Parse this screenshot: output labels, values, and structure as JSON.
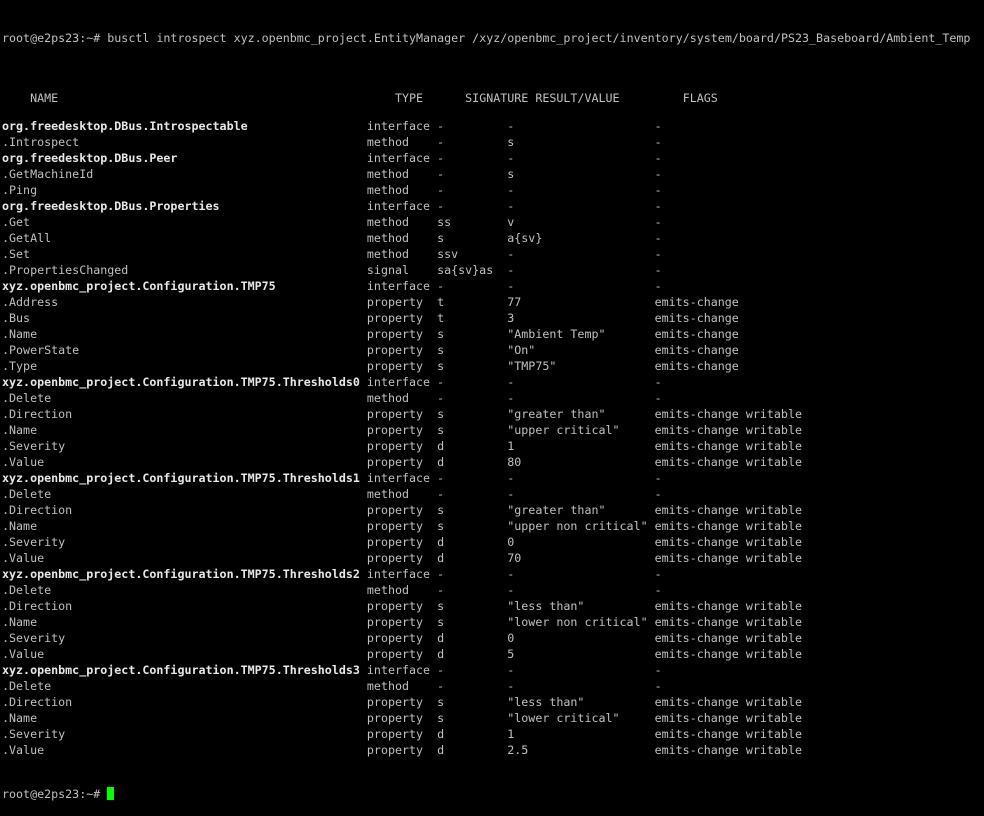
{
  "terminal": {
    "command_line": "root@e2ps23:~# busctl introspect xyz.openbmc_project.EntityManager /xyz/openbmc_project/inventory/system/board/PS23_Baseboard/Ambient_Temp",
    "headers": [
      "NAME",
      "TYPE",
      "SIGNATURE",
      "RESULT/VALUE",
      "FLAGS"
    ],
    "rows": [
      {
        "name": "org.freedesktop.DBus.Introspectable",
        "type": "interface",
        "signature": "-",
        "result": "-",
        "flags": "-",
        "interface": true
      },
      {
        "name": ".Introspect",
        "type": "method",
        "signature": "-",
        "result": "s",
        "flags": "-"
      },
      {
        "name": "org.freedesktop.DBus.Peer",
        "type": "interface",
        "signature": "-",
        "result": "-",
        "flags": "-",
        "interface": true
      },
      {
        "name": ".GetMachineId",
        "type": "method",
        "signature": "-",
        "result": "s",
        "flags": "-"
      },
      {
        "name": ".Ping",
        "type": "method",
        "signature": "-",
        "result": "-",
        "flags": "-"
      },
      {
        "name": "org.freedesktop.DBus.Properties",
        "type": "interface",
        "signature": "-",
        "result": "-",
        "flags": "-",
        "interface": true
      },
      {
        "name": ".Get",
        "type": "method",
        "signature": "ss",
        "result": "v",
        "flags": "-"
      },
      {
        "name": ".GetAll",
        "type": "method",
        "signature": "s",
        "result": "a{sv}",
        "flags": "-"
      },
      {
        "name": ".Set",
        "type": "method",
        "signature": "ssv",
        "result": "-",
        "flags": "-"
      },
      {
        "name": ".PropertiesChanged",
        "type": "signal",
        "signature": "sa{sv}as",
        "result": "-",
        "flags": "-"
      },
      {
        "name": "xyz.openbmc_project.Configuration.TMP75",
        "type": "interface",
        "signature": "-",
        "result": "-",
        "flags": "-",
        "interface": true
      },
      {
        "name": ".Address",
        "type": "property",
        "signature": "t",
        "result": "77",
        "flags": "emits-change"
      },
      {
        "name": ".Bus",
        "type": "property",
        "signature": "t",
        "result": "3",
        "flags": "emits-change"
      },
      {
        "name": ".Name",
        "type": "property",
        "signature": "s",
        "result": "\"Ambient Temp\"",
        "flags": "emits-change"
      },
      {
        "name": ".PowerState",
        "type": "property",
        "signature": "s",
        "result": "\"On\"",
        "flags": "emits-change"
      },
      {
        "name": ".Type",
        "type": "property",
        "signature": "s",
        "result": "\"TMP75\"",
        "flags": "emits-change"
      },
      {
        "name": "xyz.openbmc_project.Configuration.TMP75.Thresholds0",
        "type": "interface",
        "signature": "-",
        "result": "-",
        "flags": "-",
        "interface": true
      },
      {
        "name": ".Delete",
        "type": "method",
        "signature": "-",
        "result": "-",
        "flags": "-"
      },
      {
        "name": ".Direction",
        "type": "property",
        "signature": "s",
        "result": "\"greater than\"",
        "flags": "emits-change writable"
      },
      {
        "name": ".Name",
        "type": "property",
        "signature": "s",
        "result": "\"upper critical\"",
        "flags": "emits-change writable"
      },
      {
        "name": ".Severity",
        "type": "property",
        "signature": "d",
        "result": "1",
        "flags": "emits-change writable"
      },
      {
        "name": ".Value",
        "type": "property",
        "signature": "d",
        "result": "80",
        "flags": "emits-change writable"
      },
      {
        "name": "xyz.openbmc_project.Configuration.TMP75.Thresholds1",
        "type": "interface",
        "signature": "-",
        "result": "-",
        "flags": "-",
        "interface": true
      },
      {
        "name": ".Delete",
        "type": "method",
        "signature": "-",
        "result": "-",
        "flags": "-"
      },
      {
        "name": ".Direction",
        "type": "property",
        "signature": "s",
        "result": "\"greater than\"",
        "flags": "emits-change writable"
      },
      {
        "name": ".Name",
        "type": "property",
        "signature": "s",
        "result": "\"upper non critical\"",
        "flags": "emits-change writable"
      },
      {
        "name": ".Severity",
        "type": "property",
        "signature": "d",
        "result": "0",
        "flags": "emits-change writable"
      },
      {
        "name": ".Value",
        "type": "property",
        "signature": "d",
        "result": "70",
        "flags": "emits-change writable"
      },
      {
        "name": "xyz.openbmc_project.Configuration.TMP75.Thresholds2",
        "type": "interface",
        "signature": "-",
        "result": "-",
        "flags": "-",
        "interface": true
      },
      {
        "name": ".Delete",
        "type": "method",
        "signature": "-",
        "result": "-",
        "flags": "-"
      },
      {
        "name": ".Direction",
        "type": "property",
        "signature": "s",
        "result": "\"less than\"",
        "flags": "emits-change writable"
      },
      {
        "name": ".Name",
        "type": "property",
        "signature": "s",
        "result": "\"lower non critical\"",
        "flags": "emits-change writable"
      },
      {
        "name": ".Severity",
        "type": "property",
        "signature": "d",
        "result": "0",
        "flags": "emits-change writable"
      },
      {
        "name": ".Value",
        "type": "property",
        "signature": "d",
        "result": "5",
        "flags": "emits-change writable"
      },
      {
        "name": "xyz.openbmc_project.Configuration.TMP75.Thresholds3",
        "type": "interface",
        "signature": "-",
        "result": "-",
        "flags": "-",
        "interface": true
      },
      {
        "name": ".Delete",
        "type": "method",
        "signature": "-",
        "result": "-",
        "flags": "-"
      },
      {
        "name": ".Direction",
        "type": "property",
        "signature": "s",
        "result": "\"less than\"",
        "flags": "emits-change writable"
      },
      {
        "name": ".Name",
        "type": "property",
        "signature": "s",
        "result": "\"lower critical\"",
        "flags": "emits-change writable"
      },
      {
        "name": ".Severity",
        "type": "property",
        "signature": "d",
        "result": "1",
        "flags": "emits-change writable"
      },
      {
        "name": ".Value",
        "type": "property",
        "signature": "d",
        "result": "2.5",
        "flags": "emits-change writable"
      }
    ],
    "prompt": "root@e2ps23:~# ",
    "cursor_color": "#00ff00"
  }
}
